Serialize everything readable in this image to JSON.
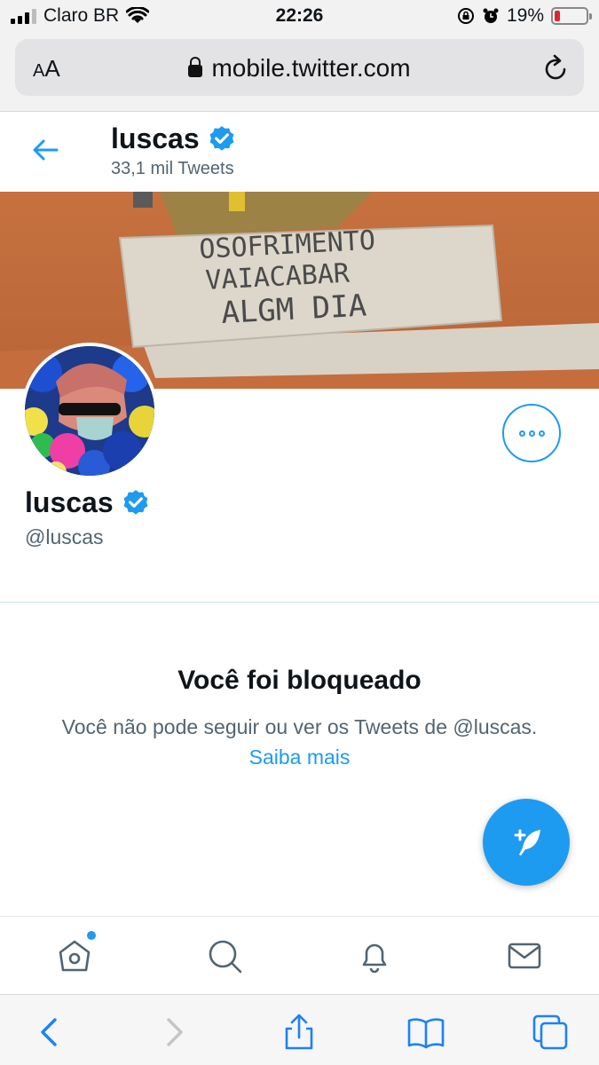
{
  "status_bar": {
    "carrier": "Claro BR",
    "time": "22:26",
    "battery_percent": "19%",
    "battery_level": 0.19,
    "icons": [
      "signal-icon",
      "wifi-icon",
      "rotation-lock-icon",
      "alarm-icon",
      "battery-icon"
    ]
  },
  "browser": {
    "text_size_label_small": "A",
    "text_size_label_large": "A",
    "url": "mobile.twitter.com",
    "icons": [
      "lock-icon",
      "reload-icon"
    ]
  },
  "header": {
    "name": "luscas",
    "tweet_count": "33,1 mil Tweets",
    "icons": [
      "back-arrow-icon",
      "verified-badge-icon"
    ]
  },
  "banner": {
    "sign_lines": [
      "OSOFRIMENTO",
      "VAIACABAR",
      "ALGM DIA"
    ]
  },
  "profile": {
    "name": "luscas",
    "handle": "@luscas",
    "icons": [
      "verified-badge-icon",
      "more-options-icon"
    ]
  },
  "blocked": {
    "title": "Você foi bloqueado",
    "message": "Você não pode seguir ou ver os Tweets de @luscas.",
    "learn_more": "Saiba mais"
  },
  "colors": {
    "accent": "#1d9bf0",
    "text_primary": "#0f1419",
    "text_secondary": "#536471",
    "battery_low": "#e0262b"
  },
  "nav": {
    "items": [
      "home-icon",
      "search-icon",
      "notifications-icon",
      "messages-icon"
    ]
  },
  "safari_toolbar": {
    "items": [
      "back-icon",
      "forward-icon",
      "share-icon",
      "bookmarks-icon",
      "tabs-icon"
    ]
  },
  "fab": {
    "icon": "compose-tweet-icon"
  }
}
